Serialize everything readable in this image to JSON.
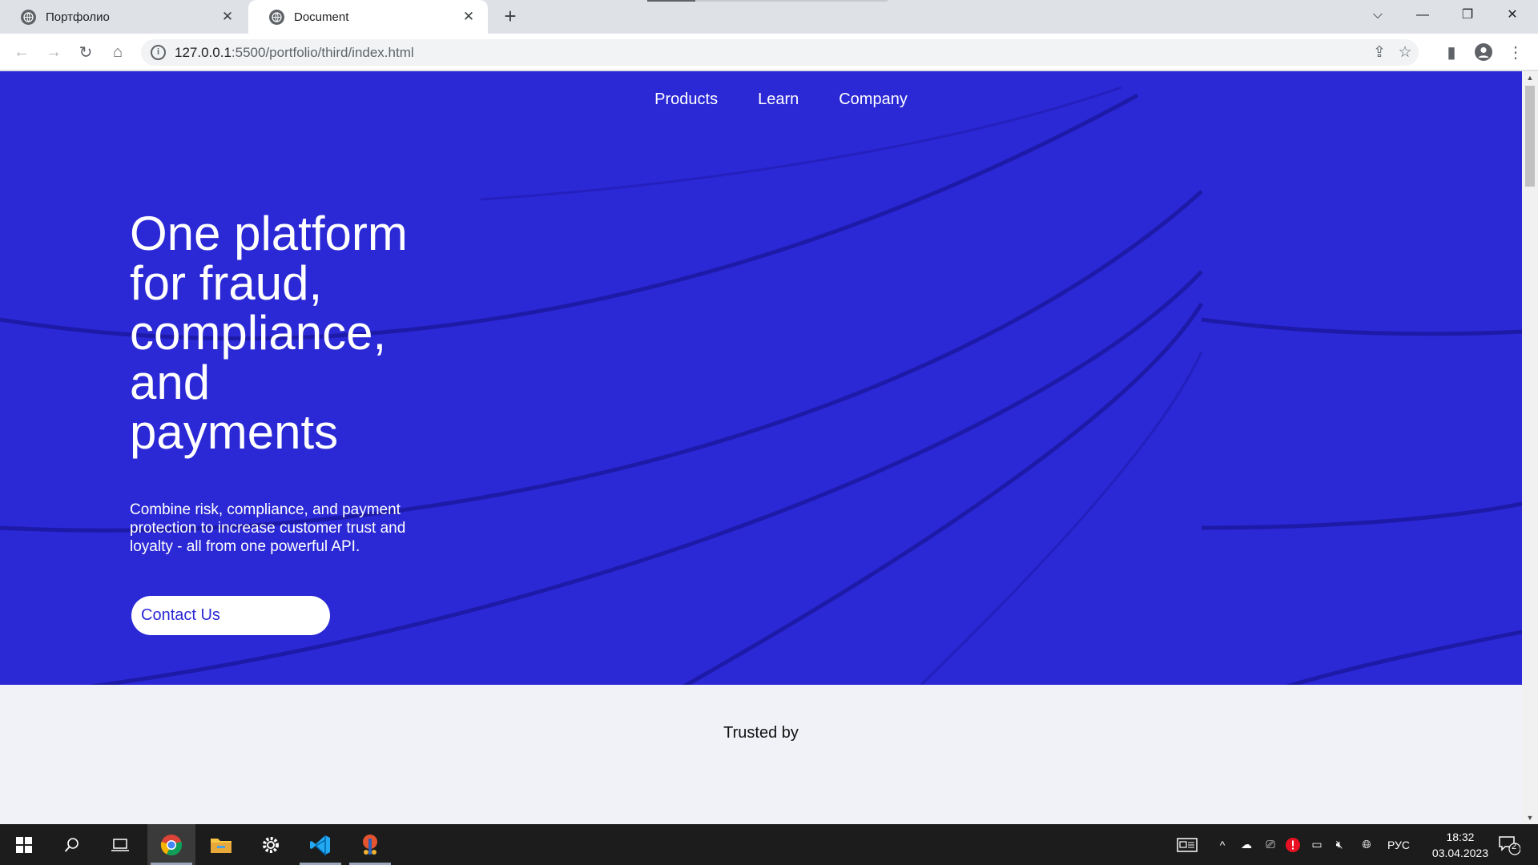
{
  "browser": {
    "tabs": [
      {
        "title": "Портфолио",
        "active": false
      },
      {
        "title": "Document",
        "active": true
      }
    ],
    "new_tab_label": "+",
    "url_host": "127.0.0.1",
    "url_rest": ":5500/portfolio/third/index.html"
  },
  "page": {
    "nav": [
      "Products",
      "Learn",
      "Company"
    ],
    "hero_title_lines": [
      "One platform",
      "for fraud,",
      "compliance,",
      "and",
      "payments"
    ],
    "hero_subtitle": "Combine risk, compliance, and payment protection to increase customer trust and loyalty - all from one powerful API.",
    "cta_label": "Contact Us",
    "trusted_label": "Trusted by"
  },
  "taskbar": {
    "language": "РУС",
    "time": "18:32",
    "date": "03.04.2023",
    "notifications_count": "2"
  },
  "colors": {
    "hero_bg": "#2b28d6",
    "hero_lines": "#1d1aa8",
    "page_bg": "#f1f2f7"
  }
}
